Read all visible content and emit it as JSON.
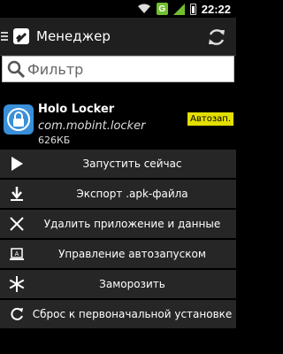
{
  "status_bar": {
    "time": "22:22",
    "network_badge": "G",
    "icons": [
      "wifi-icon",
      "signal-icon",
      "battery-icon"
    ]
  },
  "action_bar": {
    "title": "Менеджер",
    "icons": [
      "menu-icon",
      "app-icon",
      "refresh-icon"
    ]
  },
  "search": {
    "placeholder": "Фильтр",
    "value": ""
  },
  "app": {
    "name": "Holo Locker",
    "package": "com.mobint.locker",
    "size": "626КБ",
    "badge": "Автозап."
  },
  "actions": [
    {
      "label": "Запустить сейчас",
      "icon": "play-icon"
    },
    {
      "label": "Экспорт .apk-файла",
      "icon": "download-icon"
    },
    {
      "label": "Удалить приложение и данные",
      "icon": "close-icon"
    },
    {
      "label": "Управление автозапуском",
      "icon": "autostart-icon"
    },
    {
      "label": "Заморозить",
      "icon": "snowflake-icon"
    },
    {
      "label": "Сброс к первоначальной установке",
      "icon": "reset-icon"
    }
  ],
  "colors": {
    "badge": "#e3df00",
    "action_bg": "#262626",
    "app_icon": "#3a8fd8"
  }
}
